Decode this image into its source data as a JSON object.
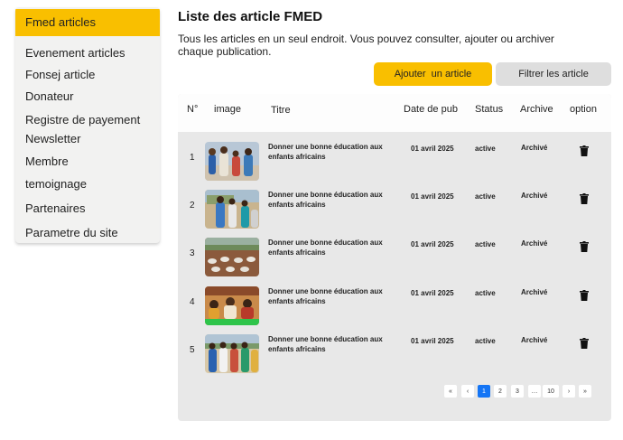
{
  "sidebar": {
    "items": [
      {
        "label": "Fmed articles",
        "active": true
      },
      {
        "label": "Evenement articles"
      },
      {
        "label": "Fonsej article"
      },
      {
        "label": "Donateur"
      },
      {
        "label": "Registre de payement"
      },
      {
        "label": "Newsletter"
      },
      {
        "label": "Membre"
      },
      {
        "label": "temoignage"
      },
      {
        "label": "Partenaires"
      },
      {
        "label": "Parametre du site"
      }
    ]
  },
  "header": {
    "title": "Liste des article FMED",
    "description": "Tous les articles en un seul endroit. Vous pouvez consulter, ajouter ou archiver chaque publication."
  },
  "actions": {
    "add_label": "Ajouter  un article",
    "filter_label": "Filtrer les article"
  },
  "table": {
    "columns": [
      "N°",
      "image",
      "Titre",
      "Date de pub",
      "Status",
      "Archive",
      "option"
    ],
    "rows": [
      {
        "num": "1",
        "title": "Donner une bonne éducation aux enfants africains",
        "date": "01 avril 2025",
        "status": "active",
        "archive": "Archivé"
      },
      {
        "num": "2",
        "title": "Donner une bonne éducation aux enfants africains",
        "date": "01 avril 2025",
        "status": "active",
        "archive": "Archivé"
      },
      {
        "num": "3",
        "title": "Donner une bonne éducation aux enfants africains",
        "date": "01 avril 2025",
        "status": "active",
        "archive": "Archivé"
      },
      {
        "num": "4",
        "title": "Donner une bonne éducation aux enfants africains",
        "date": "01 avril 2025",
        "status": "active",
        "archive": "Archivé"
      },
      {
        "num": "5",
        "title": "Donner une bonne éducation aux enfants africains",
        "date": "01 avril 2025",
        "status": "active",
        "archive": "Archivé"
      }
    ]
  },
  "pagination": {
    "first": "«",
    "prev": "‹",
    "pages": [
      "1",
      "2",
      "3",
      "…",
      "10"
    ],
    "current": "1",
    "next": "›",
    "last": "»"
  },
  "icons": {
    "row_action": "trash-icon"
  },
  "colors": {
    "accent": "#f9bf00",
    "pager_active": "#1475f5",
    "card_bg": "#e8e8e8"
  }
}
